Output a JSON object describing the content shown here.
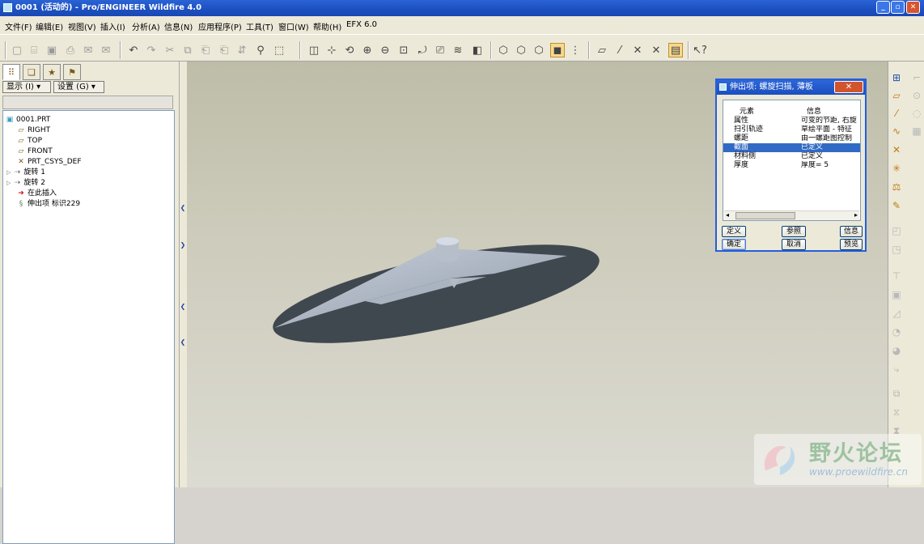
{
  "window": {
    "title": "0001 (活动的) - Pro/ENGINEER Wildfire 4.0",
    "controls": {
      "minimize": "_",
      "maximize": "▫",
      "close": "✕"
    }
  },
  "menubar": {
    "items": [
      "文件(F)",
      "编辑(E)",
      "视图(V)",
      "插入(I)",
      "分析(A)",
      "信息(N)",
      "应用程序(P)",
      "工具(T)",
      "窗口(W)",
      "帮助(H)",
      "EFX 6.0"
    ]
  },
  "toolbar": {
    "icons": [
      "new-icon",
      "open-icon",
      "save-icon",
      "print-icon",
      "email-icon",
      "email-link-icon",
      "undo-icon",
      "redo-icon",
      "cut-icon",
      "copy-icon",
      "paste-icon",
      "paste-special-icon",
      "regenerate-icon",
      "find-icon",
      "select-box-icon",
      "repaint-icon",
      "spin-center-icon",
      "orient-icon",
      "zoom-in-icon",
      "zoom-out-icon",
      "refit-icon",
      "reorient-icon",
      "saved-views-icon",
      "layers-icon",
      "appearance-icon",
      "wireframe-icon",
      "hidden-line-icon",
      "no-hidden-icon",
      "shading-icon",
      "model-tree-toggle-icon",
      "datum-planes-icon",
      "datum-axes-icon",
      "datum-points-icon",
      "coordinate-systems-icon",
      "annotations-icon",
      "whats-this-icon"
    ]
  },
  "left_panel": {
    "tabs": [
      "model-tree-tab",
      "layers-tab",
      "favorites-tab",
      "navigator-tab"
    ],
    "show_button": "显示 (I) ▾",
    "settings_button": "设置 (G) ▾",
    "tree": [
      {
        "label": "0001.PRT",
        "icon": "part-icon",
        "indent": 0
      },
      {
        "label": "RIGHT",
        "icon": "datum-plane-icon",
        "indent": 1
      },
      {
        "label": "TOP",
        "icon": "datum-plane-icon",
        "indent": 1
      },
      {
        "label": "FRONT",
        "icon": "datum-plane-icon",
        "indent": 1
      },
      {
        "label": "PRT_CSYS_DEF",
        "icon": "csys-icon",
        "indent": 1
      },
      {
        "label": "旋转 1",
        "icon": "revolve-icon",
        "indent": 1
      },
      {
        "label": "旋转 2",
        "icon": "revolve-icon",
        "indent": 1
      },
      {
        "label": "在此插入",
        "icon": "insert-arrow-icon",
        "indent": 1
      },
      {
        "label": "伸出项 标识229",
        "icon": "helical-sweep-icon",
        "indent": 1
      }
    ]
  },
  "dialog": {
    "title": "伸出项: 螺旋扫描, 薄板",
    "close": "✕",
    "columns": [
      "元素",
      "信息"
    ],
    "rows": [
      {
        "element": "属性",
        "info": "可变的节距, 右旋"
      },
      {
        "element": "扫引轨迹",
        "info": "草绘平面 - 特征"
      },
      {
        "element": "螺距",
        "info": "由一螺距图控制"
      },
      {
        "element": "截面",
        "info": "已定义",
        "selected": true
      },
      {
        "element": "材料侧",
        "info": "已定义"
      },
      {
        "element": "厚度",
        "info": "厚度= 5"
      }
    ],
    "buttons": {
      "define": "定义",
      "refs": "参照",
      "info": "信息",
      "ok": "确定",
      "cancel": "取消",
      "preview": "预览"
    }
  },
  "watermark": {
    "name": "野火论坛",
    "url": "www.proewildfire.cn"
  }
}
